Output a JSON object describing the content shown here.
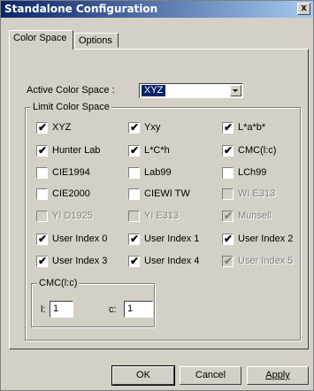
{
  "window": {
    "title": "Standalone Configuration",
    "close": "x"
  },
  "tabs": [
    {
      "label": "Color Space",
      "active": true
    },
    {
      "label": "Options",
      "active": false
    }
  ],
  "active_color_space": {
    "label": "Active Color Space :",
    "value": "XYZ"
  },
  "limit_group": {
    "legend": "Limit Color Space",
    "items": [
      {
        "label": "XYZ",
        "checked": true,
        "enabled": true
      },
      {
        "label": "Yxy",
        "checked": true,
        "enabled": true
      },
      {
        "label": "L*a*b*",
        "checked": true,
        "enabled": true
      },
      {
        "label": "Hunter Lab",
        "checked": true,
        "enabled": true
      },
      {
        "label": "L*C*h",
        "checked": true,
        "enabled": true
      },
      {
        "label": "CMC(l:c)",
        "checked": true,
        "enabled": true
      },
      {
        "label": "CIE1994",
        "checked": false,
        "enabled": true
      },
      {
        "label": "Lab99",
        "checked": false,
        "enabled": true
      },
      {
        "label": "LCh99",
        "checked": false,
        "enabled": true
      },
      {
        "label": "CIE2000",
        "checked": false,
        "enabled": true
      },
      {
        "label": "CIEWI TW",
        "checked": false,
        "enabled": true
      },
      {
        "label": "WI E313",
        "checked": false,
        "enabled": false
      },
      {
        "label": "YI D1925",
        "checked": false,
        "enabled": false
      },
      {
        "label": "YI E313",
        "checked": false,
        "enabled": false
      },
      {
        "label": "Munsell",
        "checked": true,
        "enabled": false
      },
      {
        "label": "User Index 0",
        "checked": true,
        "enabled": true
      },
      {
        "label": "User Index 1",
        "checked": true,
        "enabled": true
      },
      {
        "label": "User Index 2",
        "checked": true,
        "enabled": true
      },
      {
        "label": "User Index 3",
        "checked": true,
        "enabled": true
      },
      {
        "label": "User Index 4",
        "checked": true,
        "enabled": true
      },
      {
        "label": "User Index 5",
        "checked": true,
        "enabled": false
      }
    ]
  },
  "cmc_group": {
    "legend": "CMC(l:c)",
    "l_label": "l:",
    "l_value": "1",
    "c_label": "c:",
    "c_value": "1"
  },
  "buttons": {
    "ok": "OK",
    "cancel": "Cancel",
    "apply": "Apply"
  },
  "check_glyph": "✔"
}
